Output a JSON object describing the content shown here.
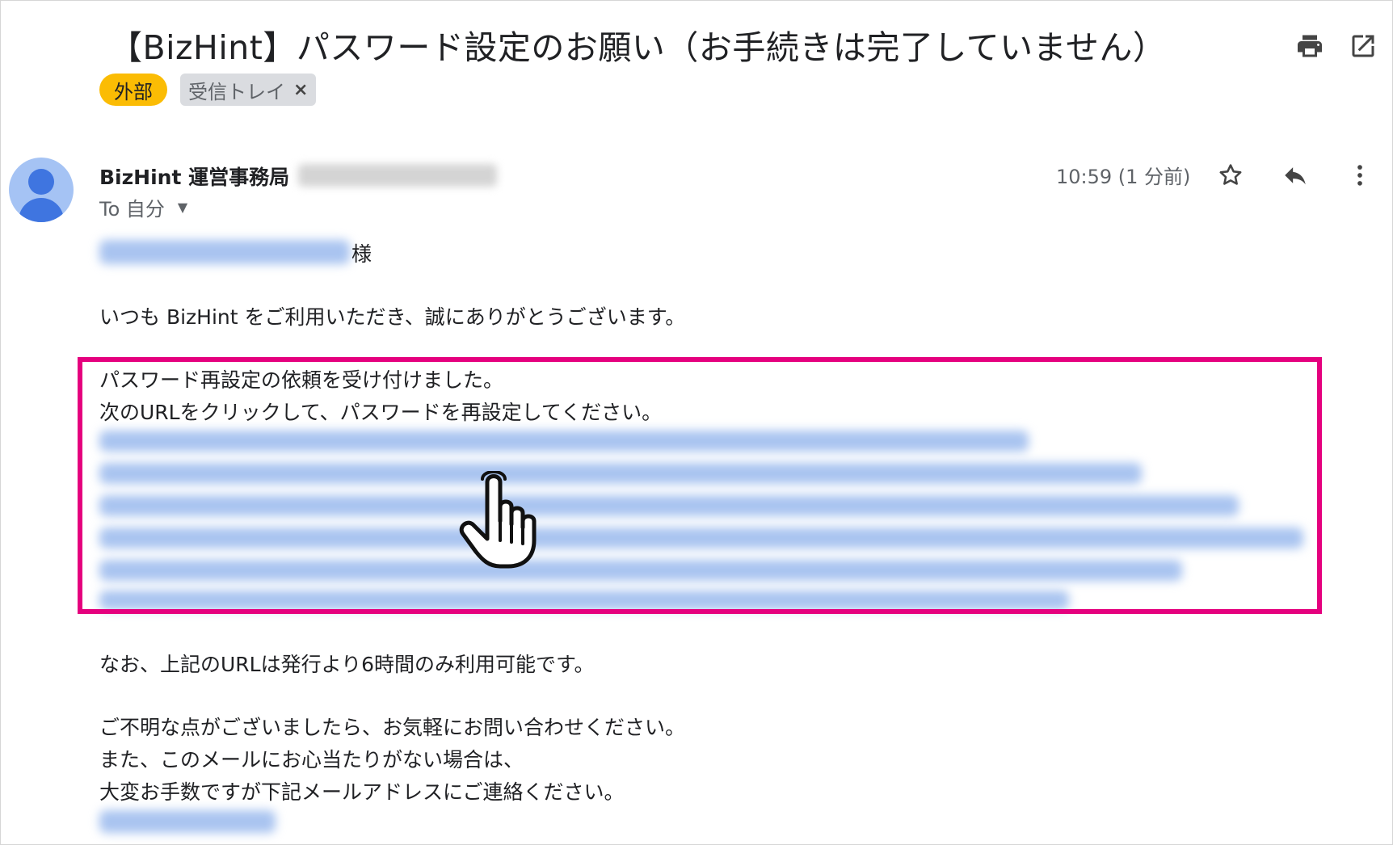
{
  "email": {
    "subject": "【BizHint】パスワード設定のお願い（お手続きは完了していません）",
    "labels": {
      "external": "外部",
      "inbox": "受信トレイ",
      "inbox_remove": "×"
    },
    "sender_name": "BizHint 運営事務局",
    "to_label": "To 自分",
    "time": "10:59 (1 分前)",
    "body": {
      "greeting_suffix": "様",
      "line_thanks": "いつも BizHint をご利用いただき、誠にありがとうございます。",
      "line_request": "パスワード再設定の依頼を受け付けました。",
      "line_click": "次のURLをクリックして、パスワードを再設定してください。",
      "line_expiry": "なお、上記のURLは発行より6時間のみ利用可能です。",
      "line_contact1": "ご不明な点がございましたら、お気軽にお問い合わせください。",
      "line_contact2": "また、このメールにお心当たりがない場合は、",
      "line_contact3": "大変お手数ですが下記メールアドレスにご連絡ください。"
    }
  },
  "icons": {
    "print": "print-icon",
    "open_new": "open-in-new-icon",
    "star": "star-icon",
    "reply": "reply-icon",
    "more": "more-vert-icon",
    "avatar": "avatar-icon",
    "hand": "hand-pointer-icon",
    "caret": "caret-down-icon"
  },
  "colors": {
    "highlight": "#e5007e",
    "external_chip": "#fbbc04",
    "inbox_chip": "#dadce0",
    "avatar_bg": "#a5c3f4",
    "avatar_fg": "#3f75e0",
    "link_blur": "#a9c4f0"
  }
}
